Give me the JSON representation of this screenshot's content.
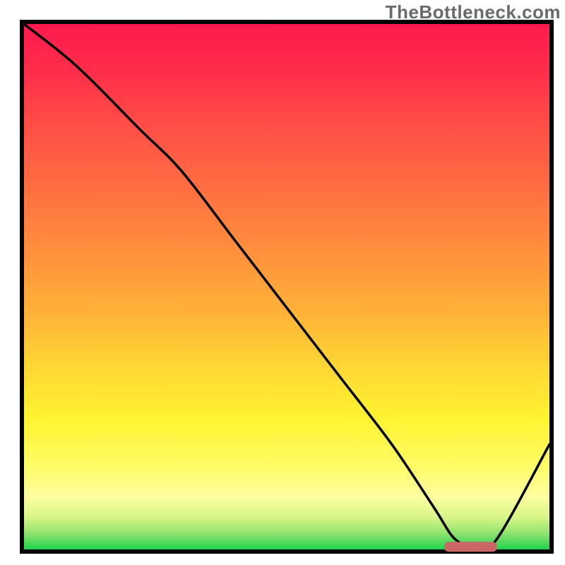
{
  "watermark": "TheBottleneck.com",
  "chart_data": {
    "type": "line",
    "title": "",
    "xlabel": "",
    "ylabel": "",
    "xlim": [
      0,
      100
    ],
    "ylim": [
      0,
      100
    ],
    "series": [
      {
        "name": "bottleneck-curve",
        "x": [
          0,
          10,
          22,
          30,
          40,
          50,
          60,
          70,
          78,
          82,
          86,
          90,
          100
        ],
        "y": [
          100,
          92,
          80,
          72,
          59,
          46,
          33,
          20,
          8,
          2,
          0.5,
          2,
          20
        ]
      }
    ],
    "marker": {
      "name": "optimal-range",
      "x_start": 80,
      "x_end": 90,
      "y": 0.5
    },
    "gradient_stops": [
      {
        "pos": 0.0,
        "color": "#ff1a4d"
      },
      {
        "pos": 0.3,
        "color": "#ff6b42"
      },
      {
        "pos": 0.55,
        "color": "#ffb238"
      },
      {
        "pos": 0.75,
        "color": "#fff431"
      },
      {
        "pos": 0.94,
        "color": "#d6f586"
      },
      {
        "pos": 1.0,
        "color": "#1fd24e"
      }
    ]
  }
}
